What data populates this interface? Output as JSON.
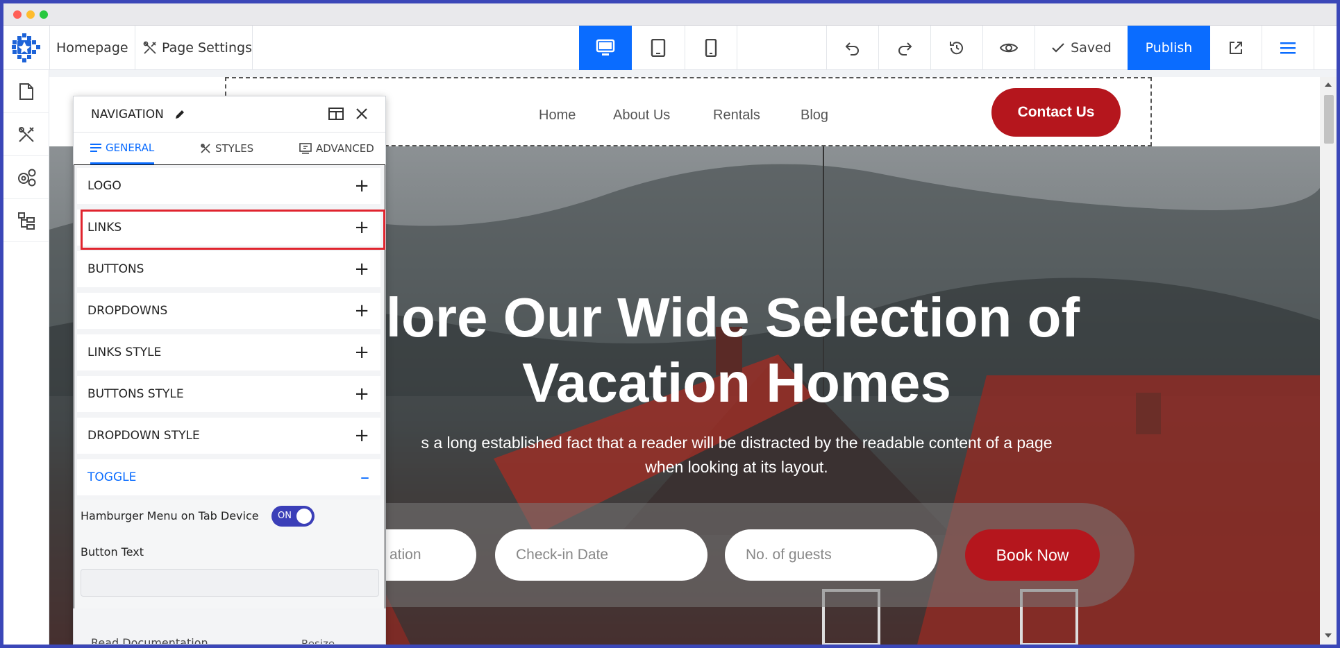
{
  "topbar": {
    "breadcrumb_page": "Homepage",
    "page_settings_label": "Page Settings",
    "saved_label": "Saved",
    "publish_label": "Publish",
    "accent_color": "#0a6cff"
  },
  "site": {
    "nav_links": [
      "Home",
      "About Us",
      "Rentals",
      "Blog"
    ],
    "contact_label": "Contact Us",
    "hero_title_line1": "plore Our Wide Selection of",
    "hero_title_line2": "Vacation Homes",
    "hero_sub_line1": "s a long established fact that a reader will be distracted by the readable content of a page",
    "hero_sub_line2": "when looking at its layout.",
    "field_location": "ation",
    "field_checkin": "Check-in Date",
    "field_guests": "No. of guests",
    "book_label": "Book Now",
    "brand_red": "#b5161d"
  },
  "panel": {
    "title": "NAVIGATION",
    "tabs": [
      "GENERAL",
      "STYLES",
      "ADVANCED"
    ],
    "sections": [
      "LOGO",
      "LINKS",
      "BUTTONS",
      "DROPDOWNS",
      "LINKS STYLE",
      "BUTTONS STYLE",
      "DROPDOWN STYLE",
      "TOGGLE"
    ],
    "hamburger_label": "Hamburger Menu on Tab Device",
    "switch_label": "ON",
    "button_text_label": "Button Text",
    "button_text_value": "",
    "footer_doc": "Read Documentation",
    "footer_resize": "Resize"
  }
}
